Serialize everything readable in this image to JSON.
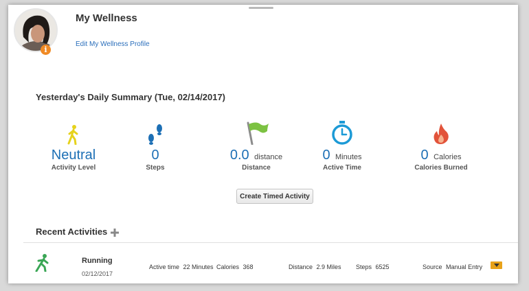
{
  "header": {
    "title": "My Wellness",
    "edit_link": "Edit My Wellness Profile",
    "info_badge": "i"
  },
  "summary": {
    "heading": "Yesterday's Daily Summary (Tue, 02/14/2017)",
    "metrics": [
      {
        "icon": "walking-person-icon",
        "value": "Neutral",
        "unit": "",
        "label": "Activity Level"
      },
      {
        "icon": "footprints-icon",
        "value": "0",
        "unit": "",
        "label": "Steps"
      },
      {
        "icon": "flag-icon",
        "value": "0.0",
        "unit": "distance",
        "label": "Distance"
      },
      {
        "icon": "stopwatch-icon",
        "value": "0",
        "unit": "Minutes",
        "label": "Active Time"
      },
      {
        "icon": "flame-icon",
        "value": "0",
        "unit": "Calories",
        "label": "Calories Burned"
      }
    ],
    "create_button": "Create Timed Activity"
  },
  "recent": {
    "heading": "Recent Activities",
    "activities": [
      {
        "name": "Running",
        "date": "02/12/2017",
        "active_time_label": "Active time",
        "active_time_value": "22 Minutes",
        "calories_label": "Calories",
        "calories_value": "368",
        "distance_label": "Distance",
        "distance_value": "2.9 Miles",
        "steps_label": "Steps",
        "steps_value": "6525",
        "source_label": "Source",
        "source_value": "Manual Entry"
      }
    ]
  },
  "colors": {
    "accent_blue": "#1c6fb5",
    "link_blue": "#2a6ebb",
    "badge_orange": "#f08a24",
    "activity_yellow": "#e6d21c",
    "flag_green": "#7cc242",
    "flame_red": "#e2533a",
    "runner_green": "#3aa655"
  }
}
